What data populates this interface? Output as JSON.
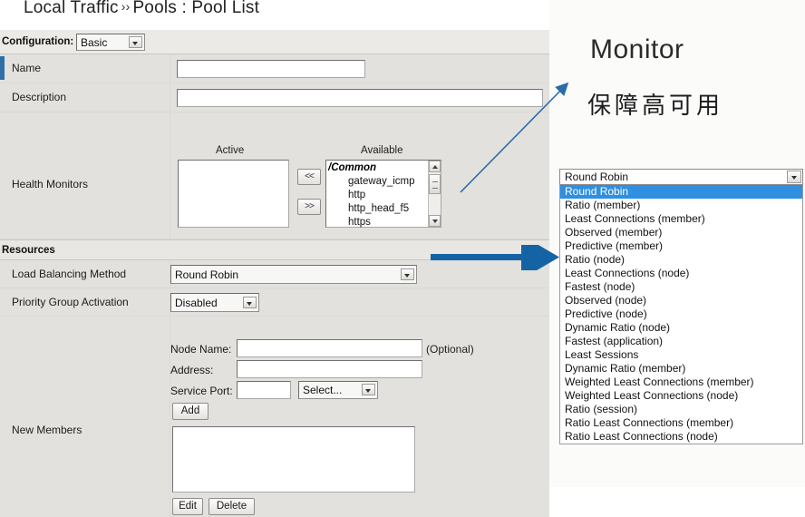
{
  "title": {
    "breadcrumb_left": "Local Traffic",
    "separator": "››",
    "breadcrumb_right": "Pools : Pool List"
  },
  "config_bar": {
    "label": "Configuration:",
    "value": "Basic"
  },
  "form": {
    "name": {
      "label": "Name",
      "value": ""
    },
    "description": {
      "label": "Description",
      "value": ""
    },
    "health_monitors": {
      "label": "Health Monitors",
      "active_header": "Active",
      "available_header": "Available",
      "active_items": [],
      "available_group": "/Common",
      "available_items": [
        "gateway_icmp",
        "http",
        "http_head_f5",
        "https"
      ],
      "move_left_label": "<<",
      "move_right_label": ">>"
    }
  },
  "resources": {
    "header": "Resources",
    "load_balancing": {
      "label": "Load Balancing Method",
      "value": "Round Robin"
    },
    "priority_group": {
      "label": "Priority Group Activation",
      "value": "Disabled"
    },
    "new_members": {
      "label": "New Members",
      "node_name_label": "Node Name:",
      "node_name_value": "",
      "optional_note": "(Optional)",
      "address_label": "Address:",
      "address_value": "",
      "service_port_label": "Service Port:",
      "service_port_value": "",
      "service_port_select": "Select...",
      "add_label": "Add",
      "edit_label": "Edit",
      "delete_label": "Delete",
      "members": []
    }
  },
  "dropdown": {
    "selected": "Round Robin",
    "options": [
      "Round Robin",
      "Ratio (member)",
      "Least Connections (member)",
      "Observed (member)",
      "Predictive (member)",
      "Ratio (node)",
      "Least Connections (node)",
      "Fastest (node)",
      "Observed (node)",
      "Predictive (node)",
      "Dynamic Ratio (node)",
      "Fastest (application)",
      "Least Sessions",
      "Dynamic Ratio (member)",
      "Weighted Least Connections (member)",
      "Weighted Least Connections (node)",
      "Ratio (session)",
      "Ratio Least Connections (member)",
      "Ratio Least Connections (node)"
    ]
  },
  "annotations": {
    "monitor_label": "Monitor",
    "monitor_cn": "保障高可用"
  },
  "colors": {
    "accent_blue": "#1f6fb4",
    "highlight_blue": "#2f8fe0",
    "required_marker": "#2f6fa8",
    "panel_bg": "#e3e1dd"
  }
}
